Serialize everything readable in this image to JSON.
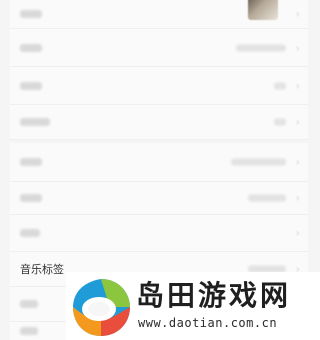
{
  "settings": {
    "music_tag_label": "音乐标签"
  },
  "watermark": {
    "title": "岛田游戏网",
    "url": "www.daotian.com.cn"
  }
}
